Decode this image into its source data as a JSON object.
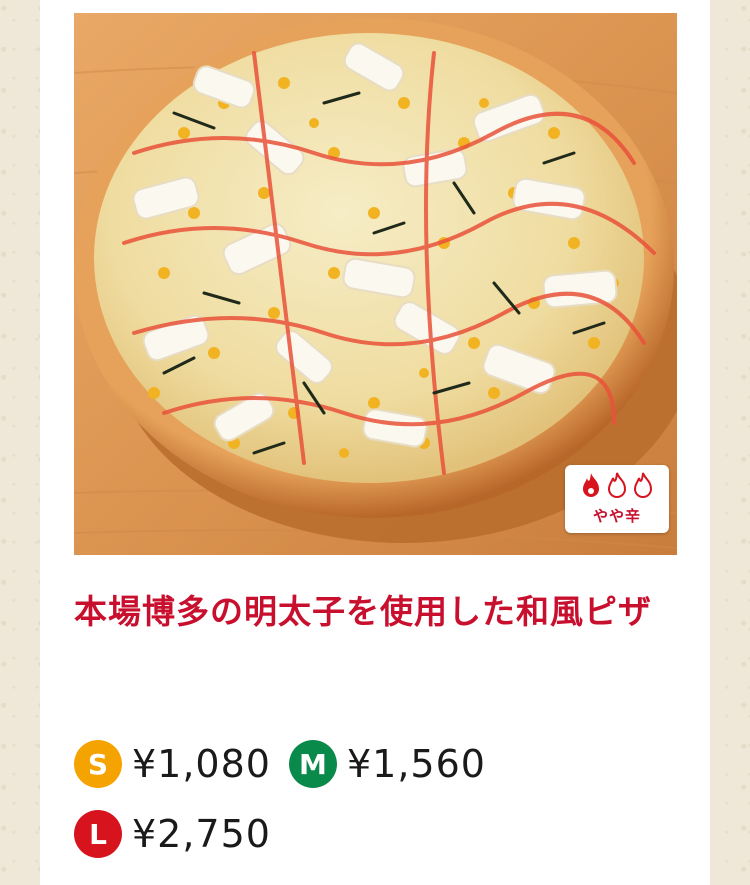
{
  "product": {
    "image_alt": "本場博多の明太子を使用した和風ピザ",
    "spice_level": {
      "label": "やや辛",
      "level": 1,
      "max": 3,
      "active_color": "#d7141e"
    },
    "title": "本場博多の明太子を使用した和風ピザ"
  },
  "prices": [
    {
      "size": "S",
      "price": "¥1,080",
      "color": "#f5a300"
    },
    {
      "size": "M",
      "price": "¥1,560",
      "color": "#0a8a4a"
    },
    {
      "size": "L",
      "price": "¥2,750",
      "color": "#d7141e"
    }
  ],
  "colors": {
    "title": "#c8102e",
    "background": "#efe8d8",
    "card": "#ffffff"
  }
}
